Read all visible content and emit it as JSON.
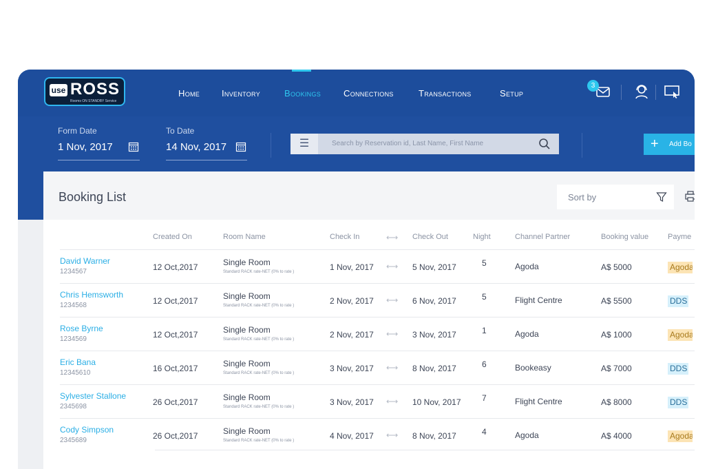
{
  "brand": {
    "logo_use": "use",
    "logo_ross": "ROSS",
    "logo_tagline": "Rooms ON STANDBY Service"
  },
  "nav": {
    "items": [
      {
        "label": "Home",
        "active": false
      },
      {
        "label": "Inventory",
        "active": false
      },
      {
        "label": "Bookings",
        "active": true
      },
      {
        "label": "Connections",
        "active": false
      },
      {
        "label": "Transactions",
        "active": false
      },
      {
        "label": "Setup",
        "active": false
      }
    ],
    "mail_badge": "3",
    "icons": [
      "mail-icon",
      "support-agent-icon",
      "screen-cursor-icon"
    ]
  },
  "filters": {
    "from_label": "Form Date",
    "from_value": "1 Nov, 2017",
    "to_label": "To Date",
    "to_value": "14 Nov, 2017",
    "search_placeholder": "Search by Reservation id, Last Name, First Name",
    "add_label": "Add Bo"
  },
  "panel": {
    "title": "Booking List",
    "sort_label": "Sort by"
  },
  "table": {
    "headers": {
      "created": "Created On",
      "room": "Room Name",
      "checkin": "Check In",
      "checkout": "Check Out",
      "night": "Night",
      "channel": "Channel Partner",
      "value": "Booking value",
      "payment": "Payme"
    },
    "rows": [
      {
        "name": "David Warner",
        "id": "1234567",
        "created": "12 Oct,2017",
        "room": "Single Room",
        "rate": "Standard RACK rate-NET (0% to rate )",
        "checkin": "1 Nov, 2017",
        "checkout": "5 Nov, 2017",
        "night": "5",
        "channel": "Agoda",
        "value": "A$ 5000",
        "payment": "Agoda",
        "pay_type": "agoda"
      },
      {
        "name": "Chris Hemsworth",
        "id": "1234568",
        "created": "12 Oct,2017",
        "room": "Single Room",
        "rate": "Standard RACK rate-NET (0% to rate )",
        "checkin": "2 Nov, 2017",
        "checkout": "6 Nov, 2017",
        "night": "5",
        "channel": "Flight Centre",
        "value": "A$ 5500",
        "payment": "DDS",
        "pay_type": "dds"
      },
      {
        "name": "Rose Byrne",
        "id": "1234569",
        "created": "12 Oct,2017",
        "room": "Single Room",
        "rate": "Standard RACK rate-NET (0% to rate )",
        "checkin": "2 Nov, 2017",
        "checkout": "3 Nov, 2017",
        "night": "1",
        "channel": "Agoda",
        "value": "A$ 1000",
        "payment": "Agoda",
        "pay_type": "agoda"
      },
      {
        "name": "Eric Bana",
        "id": "12345610",
        "created": "16 Oct,2017",
        "room": "Single Room",
        "rate": "Standard RACK rate-NET (0% to rate )",
        "checkin": "3 Nov, 2017",
        "checkout": "8 Nov, 2017",
        "night": "6",
        "channel": "Bookeasy",
        "value": "A$ 7000",
        "payment": "DDS",
        "pay_type": "dds"
      },
      {
        "name": "Sylvester Stallone",
        "id": "2345698",
        "created": "26 Oct,2017",
        "room": "Single Room",
        "rate": "Standard RACK rate-NET (0% to rate )",
        "checkin": "3 Nov, 2017",
        "checkout": "10 Nov, 2017",
        "night": "7",
        "channel": "Flight Centre",
        "value": "A$ 8000",
        "payment": "DDS",
        "pay_type": "dds"
      },
      {
        "name": "Cody Simpson",
        "id": "2345689",
        "created": "26 Oct,2017",
        "room": "Single Room",
        "rate": "Standard RACK rate-NET (0% to rate )",
        "checkin": "4 Nov, 2017",
        "checkout": "8 Nov, 2017",
        "night": "4",
        "channel": "Agoda",
        "value": "A$ 4000",
        "payment": "Agoda",
        "pay_type": "agoda"
      }
    ],
    "swap_glyph": "⟷"
  },
  "colors": {
    "primary": "#1f4f9f",
    "accent": "#2ec7ee",
    "link": "#2aaee5",
    "agoda_bg": "#fce4b5",
    "dds_bg": "#d6f0fb"
  }
}
